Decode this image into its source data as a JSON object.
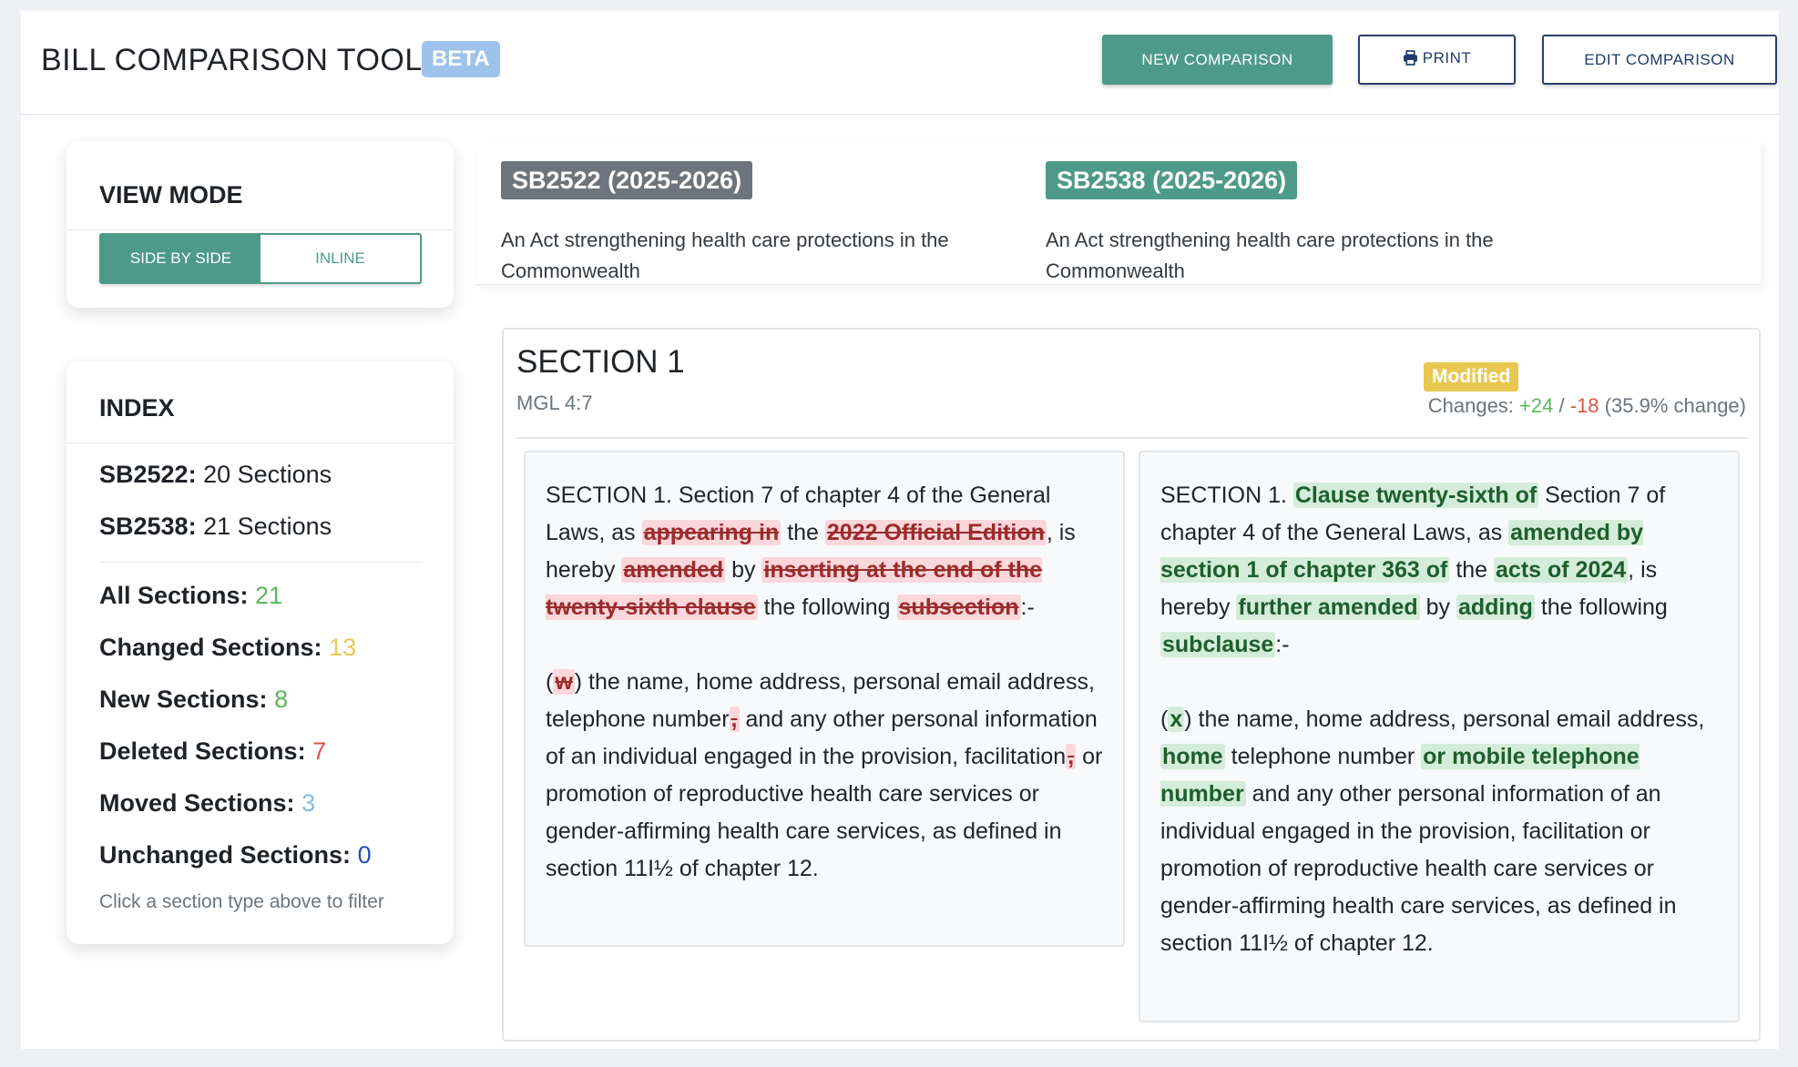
{
  "header": {
    "title": "BILL COMPARISON TOOL",
    "badge": "BETA",
    "new_comparison": "NEW COMPARISON",
    "print": "PRINT",
    "edit_comparison": "EDIT COMPARISON"
  },
  "view_mode": {
    "title": "VIEW MODE",
    "side_by_side": "SIDE BY SIDE",
    "inline": "INLINE",
    "selected": "side_by_side"
  },
  "index": {
    "title": "INDEX",
    "bills": [
      {
        "label": "SB2522:",
        "value": "20 Sections"
      },
      {
        "label": "SB2538:",
        "value": "21 Sections"
      }
    ],
    "stats": [
      {
        "label": "All Sections:",
        "value": "21",
        "color": "#5cb85c"
      },
      {
        "label": "Changed Sections:",
        "value": "13",
        "color": "#e8c850"
      },
      {
        "label": "New Sections:",
        "value": "8",
        "color": "#5cb85c"
      },
      {
        "label": "Deleted Sections:",
        "value": "7",
        "color": "#d9534f"
      },
      {
        "label": "Moved Sections:",
        "value": "3",
        "color": "#7fbde4"
      },
      {
        "label": "Unchanged Sections:",
        "value": "0",
        "color": "#1f4fbf"
      }
    ],
    "hint": "Click a section type above to filter"
  },
  "bills": {
    "old": {
      "tag": "SB2522 (2025-2026)",
      "description": "An Act strengthening health care protections in the Commonwealth"
    },
    "new": {
      "tag": "SB2538 (2025-2026)",
      "description": "An Act strengthening health care protections in the Commonwealth"
    }
  },
  "section": {
    "title": "SECTION 1",
    "subtitle": "MGL 4:7",
    "status": "Modified",
    "changes_label": "Changes:",
    "additions": "+24",
    "separator": "/",
    "deletions": "-18",
    "percent": "(35.9% change)"
  },
  "old_text": {
    "p1": [
      {
        "t": "SECTION 1. Section 7 of chapter 4 of the General Laws, as "
      },
      {
        "t": "appearing in",
        "d": true
      },
      {
        "t": " the "
      },
      {
        "t": "2022 Official Edition",
        "d": true
      },
      {
        "t": ", is hereby "
      },
      {
        "t": "amended",
        "d": true
      },
      {
        "t": " by "
      },
      {
        "t": "inserting at the end of the twenty-sixth clause",
        "d": true
      },
      {
        "t": " the following "
      },
      {
        "t": "subsection",
        "d": true
      },
      {
        "t": ":-"
      }
    ],
    "p2": [
      {
        "t": "("
      },
      {
        "t": "w",
        "d": true
      },
      {
        "t": ") the name, home address, personal email address, telephone number"
      },
      {
        "t": ",",
        "d": true
      },
      {
        "t": " and any other personal information of an individual engaged in the provision, facilitation"
      },
      {
        "t": ",",
        "d": true
      },
      {
        "t": " or promotion of reproductive health care services or gender-affirming health care services, as defined in section 11I½ of chapter 12."
      }
    ]
  },
  "new_text": {
    "p1": [
      {
        "t": "SECTION 1. "
      },
      {
        "t": "Clause twenty-sixth of",
        "i": true
      },
      {
        "t": " Section 7 of chapter 4 of the General Laws, as "
      },
      {
        "t": "amended by section 1 of chapter 363 of",
        "i": true
      },
      {
        "t": " the "
      },
      {
        "t": "acts of 2024",
        "i": true
      },
      {
        "t": ", is hereby "
      },
      {
        "t": "further amended",
        "i": true
      },
      {
        "t": " by "
      },
      {
        "t": "adding",
        "i": true
      },
      {
        "t": " the following "
      },
      {
        "t": "subclause",
        "i": true
      },
      {
        "t": ":-"
      }
    ],
    "p2": [
      {
        "t": "("
      },
      {
        "t": "x",
        "i": true
      },
      {
        "t": ") the name, home address, personal email address, "
      },
      {
        "t": "home",
        "i": true
      },
      {
        "t": " telephone number "
      },
      {
        "t": "or mobile telephone number",
        "i": true
      },
      {
        "t": " and any other personal information of an individual engaged in the provision, facilitation or promotion of reproductive health care services or gender-affirming health care services, as defined in section 11I½ of chapter 12."
      }
    ]
  }
}
